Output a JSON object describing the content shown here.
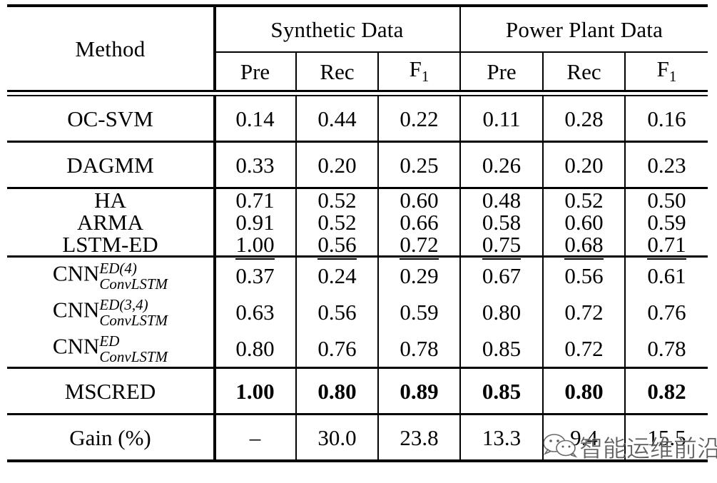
{
  "table": {
    "header": {
      "method_label": "Method",
      "groups": [
        {
          "label": "Synthetic Data"
        },
        {
          "label": "Power Plant Data"
        }
      ],
      "metrics": [
        "Pre",
        "Rec",
        "F",
        "Pre",
        "Rec",
        "F"
      ],
      "f_subscript": "1",
      "metric_labels": {
        "pre": "Pre",
        "rec": "Rec",
        "f1_base": "F",
        "f1_sub": "1"
      }
    },
    "sections": [
      {
        "rows": [
          {
            "method": "OC-SVM",
            "values": [
              "0.14",
              "0.44",
              "0.22",
              "0.11",
              "0.28",
              "0.16"
            ],
            "style": "normal"
          }
        ]
      },
      {
        "rows": [
          {
            "method": "DAGMM",
            "values": [
              "0.33",
              "0.20",
              "0.25",
              "0.26",
              "0.20",
              "0.23"
            ],
            "style": "normal"
          }
        ]
      },
      {
        "rows": [
          {
            "method": "HA",
            "values": [
              "0.71",
              "0.52",
              "0.60",
              "0.48",
              "0.52",
              "0.50"
            ],
            "style": "normal"
          },
          {
            "method": "ARMA",
            "values": [
              "0.91",
              "0.52",
              "0.66",
              "0.58",
              "0.60",
              "0.59"
            ],
            "style": "normal"
          },
          {
            "method": "LSTM-ED",
            "values": [
              "1.00",
              "0.56",
              "0.72",
              "0.75",
              "0.68",
              "0.71"
            ],
            "style": "underline"
          }
        ]
      },
      {
        "rows": [
          {
            "method_base": "CNN",
            "method_sup": "ED(4)",
            "method_sub": "ConvLSTM",
            "values": [
              "0.37",
              "0.24",
              "0.29",
              "0.67",
              "0.56",
              "0.61"
            ],
            "style": "normal"
          },
          {
            "method_base": "CNN",
            "method_sup": "ED(3,4)",
            "method_sub": "ConvLSTM",
            "values": [
              "0.63",
              "0.56",
              "0.59",
              "0.80",
              "0.72",
              "0.76"
            ],
            "style": "normal"
          },
          {
            "method_base": "CNN",
            "method_sup": "ED",
            "method_sub": "ConvLSTM",
            "values": [
              "0.80",
              "0.76",
              "0.78",
              "0.85",
              "0.72",
              "0.78"
            ],
            "style": "normal"
          }
        ]
      },
      {
        "rows": [
          {
            "method": "MSCRED",
            "values": [
              "1.00",
              "0.80",
              "0.89",
              "0.85",
              "0.80",
              "0.82"
            ],
            "style": "bold"
          }
        ]
      },
      {
        "rows": [
          {
            "method": "Gain (%)",
            "values": [
              "–",
              "30.0",
              "23.8",
              "13.3",
              "9.4",
              "15.5"
            ],
            "style": "normal"
          }
        ]
      }
    ]
  },
  "watermark": {
    "text": "智能运维前沿",
    "logo": "wechat-icon",
    "color": "#3a3a3a"
  },
  "colors": {
    "rule": "#000000",
    "text": "#000000",
    "background": "#ffffff"
  }
}
